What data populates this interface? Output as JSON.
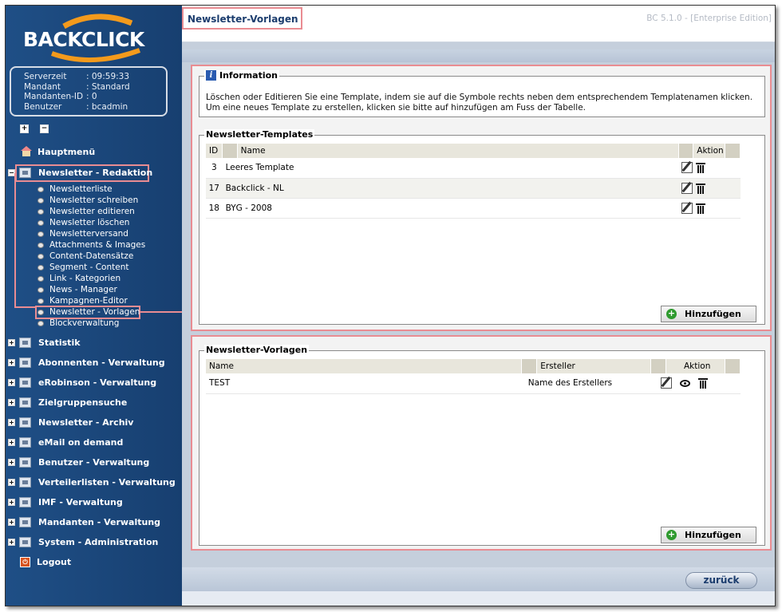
{
  "app": {
    "logo_text": "BACKCLICK",
    "version": "BC 5.1.0 - [Enterprise Edition]"
  },
  "server": {
    "rows": [
      {
        "key": "Serverzeit",
        "value": ": 09:59:33"
      },
      {
        "key": "Mandant",
        "value": ": Standard"
      },
      {
        "key": "Mandanten-ID",
        "value": ": 0"
      },
      {
        "key": "Benutzer",
        "value": ": bcadmin"
      }
    ]
  },
  "tree_controls": {
    "expand": "+",
    "collapse": "−"
  },
  "nav": {
    "home": "Hauptmenü",
    "active_group": "Newsletter - Redaktion",
    "sub_items": [
      "Newsletterliste",
      "Newsletter schreiben",
      "Newsletter editieren",
      "Newsletter löschen",
      "Newsletterversand",
      "Attachments & Images",
      "Content-Datensätze",
      "Segment - Content",
      "Link - Kategorien",
      "News - Manager",
      "Kampagnen-Editor",
      "Newsletter - Vorlagen",
      "Blockverwaltung"
    ],
    "groups": [
      "Statistik",
      "Abonnenten - Verwaltung",
      "eRobinson - Verwaltung",
      "Zielgruppensuche",
      "Newsletter - Archiv",
      "eMail on demand",
      "Benutzer - Verwaltung",
      "Verteilerlisten - Verwaltung",
      "IMF - Verwaltung",
      "Mandanten - Verwaltung",
      "System - Administration"
    ],
    "logout": "Logout"
  },
  "page": {
    "title": "Newsletter-Vorlagen"
  },
  "info": {
    "legend": "Information",
    "line1": "Löschen oder Editieren Sie eine Template, indem sie auf die Symbole rechts neben dem entsprechendem Templatenamen klicken.",
    "line2": "Um eine neues Template zu erstellen, klicken sie bitte auf hinzufügen am Fuss der Tabelle."
  },
  "templates": {
    "legend": "Newsletter-Templates",
    "columns": {
      "id": "ID",
      "name": "Name",
      "action": "Aktion"
    },
    "rows": [
      {
        "id": "3",
        "name": "Leeres Template"
      },
      {
        "id": "17",
        "name": "Backclick - NL"
      },
      {
        "id": "18",
        "name": "BYG - 2008"
      }
    ],
    "add_label": "Hinzufügen"
  },
  "vorlagen": {
    "legend": "Newsletter-Vorlagen",
    "columns": {
      "name": "Name",
      "creator": "Ersteller",
      "action": "Aktion"
    },
    "rows": [
      {
        "name": "TEST",
        "creator": "Name des Erstellers"
      }
    ],
    "add_label": "Hinzufügen"
  },
  "footer": {
    "back_label": "zurück"
  },
  "colors": {
    "sidebar": "#1f4f86",
    "highlight": "#e98c92",
    "add_icon": "#2e9a2e"
  }
}
